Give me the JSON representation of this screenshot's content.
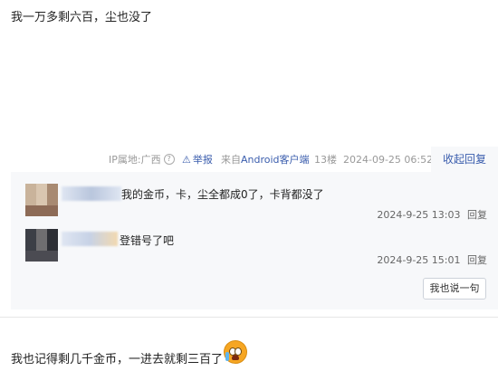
{
  "post1": {
    "text": "我一万多剩六百，尘也没了"
  },
  "meta": {
    "ip": "IP属地:广西",
    "report": "举报",
    "from_prefix": "来自",
    "from_client": "Android客户端",
    "floor": "13楼",
    "time": "2024-09-25 06:52",
    "collapse": "收起回复"
  },
  "replies": [
    {
      "text": "我的金币，卡，尘全都成0了，卡背都没了",
      "time": "2024-9-25 13:03",
      "reply": "回复"
    },
    {
      "text": "登错号了吧",
      "time": "2024-9-25 15:01",
      "reply": "回复"
    }
  ],
  "say_button": "我也说一句",
  "post2": {
    "text": "我也记得剩几千金币，一进去就剩三百了"
  },
  "colors": {
    "link": "#3a5dad",
    "panel": "#f7f8fa"
  }
}
